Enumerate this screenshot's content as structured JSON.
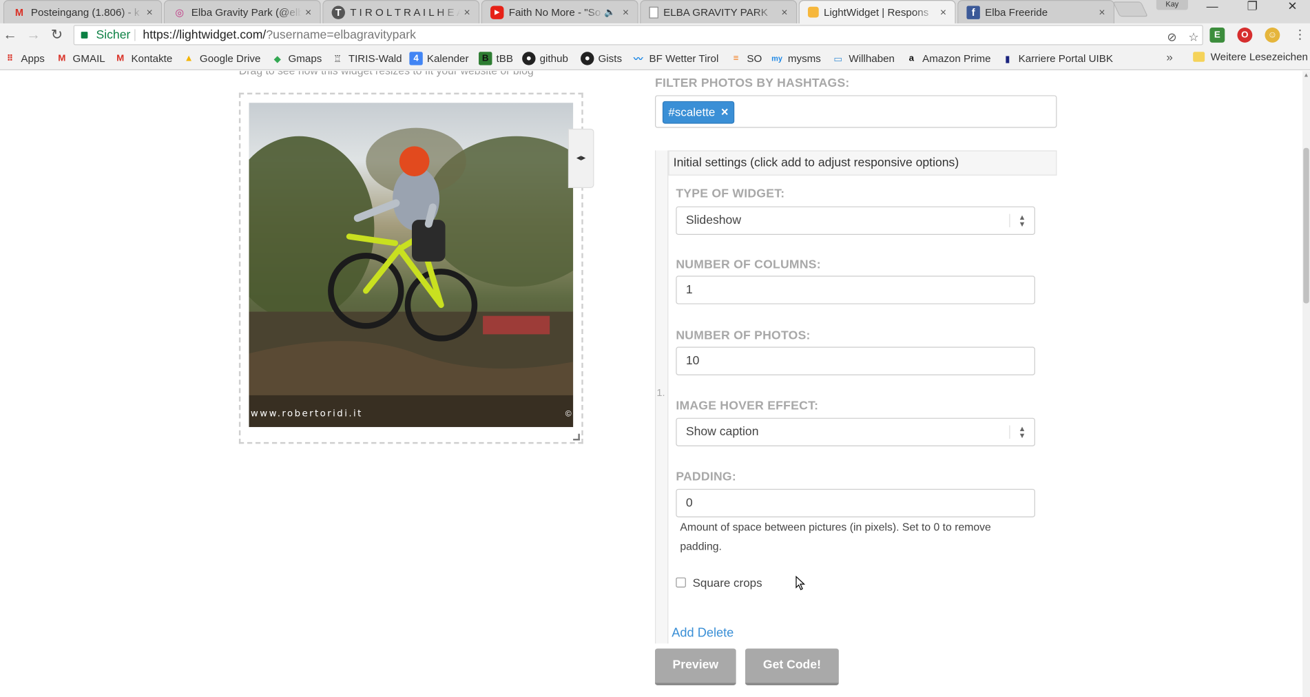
{
  "browser": {
    "tabs": [
      {
        "label": "Posteingang (1.806) - k",
        "icon": "gmail-icon",
        "left": 0
      },
      {
        "label": "Elba Gravity Park (@elb",
        "icon": "instagram-icon",
        "left": 0
      },
      {
        "label": "T I R O L T R A I L H E A",
        "icon": "trailhead-icon",
        "left": 0
      },
      {
        "label": "Faith No More - \"So",
        "icon": "youtube-icon",
        "left": 0
      },
      {
        "label": "ELBA GRAVITY PARK",
        "icon": "document-icon",
        "left": 0
      },
      {
        "label": "LightWidget | Respons",
        "icon": "lightwidget-icon",
        "left": 0
      },
      {
        "label": "Elba Freeride",
        "icon": "facebook-icon",
        "left": 0
      }
    ],
    "close_glyph": "×",
    "mute_glyph": "🔈",
    "profile_name": "Kay",
    "window": {
      "minimize": "—",
      "restore": "❐",
      "close": "✕"
    },
    "nav": {
      "back": "←",
      "forward": "→",
      "reload": "↻"
    },
    "omnibox": {
      "secure_label": "Sicher",
      "url_host": "https://lightwidget.com/",
      "url_path": "?username=elbagravitypark"
    },
    "bookmarks": [
      {
        "label": "Apps",
        "icon": "apps-icon"
      },
      {
        "label": "GMAIL",
        "icon": "gmail-icon"
      },
      {
        "label": "Kontakte",
        "icon": "gmail-icon"
      },
      {
        "label": "Google Drive",
        "icon": "drive-icon"
      },
      {
        "label": "Gmaps",
        "icon": "maps-icon"
      },
      {
        "label": "TIRIS-Wald",
        "icon": "tiris-icon"
      },
      {
        "label": "Kalender",
        "icon": "calendar-icon"
      },
      {
        "label": "tBB",
        "icon": "tbb-icon"
      },
      {
        "label": "github",
        "icon": "github-icon"
      },
      {
        "label": "Gists",
        "icon": "github-icon"
      },
      {
        "label": "BF Wetter Tirol",
        "icon": "weather-icon"
      },
      {
        "label": "SO",
        "icon": "stackoverflow-icon"
      },
      {
        "label": "mysms",
        "icon": "mysms-icon"
      },
      {
        "label": "Willhaben",
        "icon": "willhaben-icon"
      },
      {
        "label": "Amazon Prime",
        "icon": "amazon-icon"
      },
      {
        "label": "Karriere Portal UIBK",
        "icon": "uibk-icon"
      }
    ],
    "bookmarks_more": "»",
    "other_bookmarks": "Weitere Lesezeichen"
  },
  "preview": {
    "hint_text": "Drag to see how this widget resizes to fit your website or blog",
    "photo_credit": "www.robertoridi.it",
    "photo_copyright": "©",
    "drag_handle": "◂▸"
  },
  "form": {
    "hashtags_label": "FILTER PHOTOS BY HASHTAGS:",
    "hashtags": [
      {
        "text": "#scalette",
        "remove": "×"
      }
    ],
    "panel_number": "1.",
    "panel_header": "Initial settings (click add to adjust responsive options)",
    "widget_type_label": "TYPE OF WIDGET:",
    "widget_type_value": "Slideshow",
    "columns_label": "NUMBER OF COLUMNS:",
    "columns_value": "1",
    "photos_label": "NUMBER OF PHOTOS:",
    "photos_value": "10",
    "hover_label": "IMAGE HOVER EFFECT:",
    "hover_value": "Show caption",
    "padding_label": "PADDING:",
    "padding_value": "0",
    "padding_help": "Amount of space between pictures (in pixels). Set to 0 to remove padding.",
    "square_crops_label": "Square crops",
    "square_crops_checked": false,
    "add_link": "Add",
    "delete_link": "Delete",
    "preview_button": "Preview",
    "get_code_button": "Get Code!"
  },
  "colors": {
    "accent": "#3a8fd6",
    "button_gray": "#a9a9a9",
    "secure_green": "#0b8043",
    "label_gray": "#a8a8a8"
  }
}
